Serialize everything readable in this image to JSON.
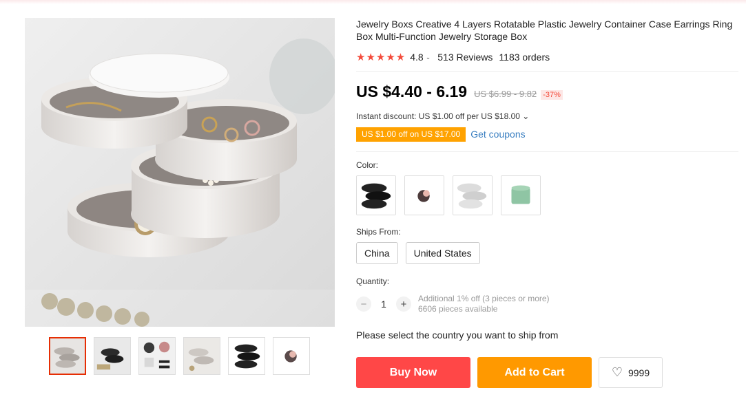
{
  "product": {
    "title": "Jewelry Boxs Creative 4 Layers Rotatable Plastic Jewelry Container Case Earrings Ring Box Multi-Function Jewelry Storage Box",
    "stars": "★★★★★",
    "rating": "4.8",
    "rating_caret": "⌄",
    "reviews": "513 Reviews",
    "orders": "1183 orders"
  },
  "price": {
    "current": "US $4.40 - 6.19",
    "original": "US $6.99 - 9.82",
    "discount": "-37%"
  },
  "promo": {
    "instant_discount": "Instant discount: US $1.00 off per US $18.00 ⌄",
    "coupon_tag": "US $1.00 off on US $17.00",
    "get_coupons": "Get coupons"
  },
  "options": {
    "color_label": "Color:",
    "colors": [
      "black",
      "rose-gold",
      "white",
      "green"
    ],
    "ships_from_label": "Ships From:",
    "ships_from": [
      "China",
      "United States"
    ],
    "quantity_label": "Quantity:",
    "quantity": "1",
    "minus": "−",
    "plus": "+",
    "qty_note1": "Additional 1% off (3 pieces or more)",
    "qty_note2": "6606 pieces available"
  },
  "shipping_prompt": "Please select the country you want to ship from",
  "actions": {
    "buy_now": "Buy Now",
    "add_to_cart": "Add to Cart",
    "wishlist_icon": "♡",
    "wishlist_count": "9999"
  },
  "gallery": {
    "thumbnail_count": 6,
    "active_index": 0
  },
  "colors": {
    "accent_red": "#ff4747",
    "accent_orange": "#ff9900",
    "star_red": "#f44b3b",
    "coupon_orange": "#ffa200",
    "link_blue": "#3a7fc1"
  }
}
